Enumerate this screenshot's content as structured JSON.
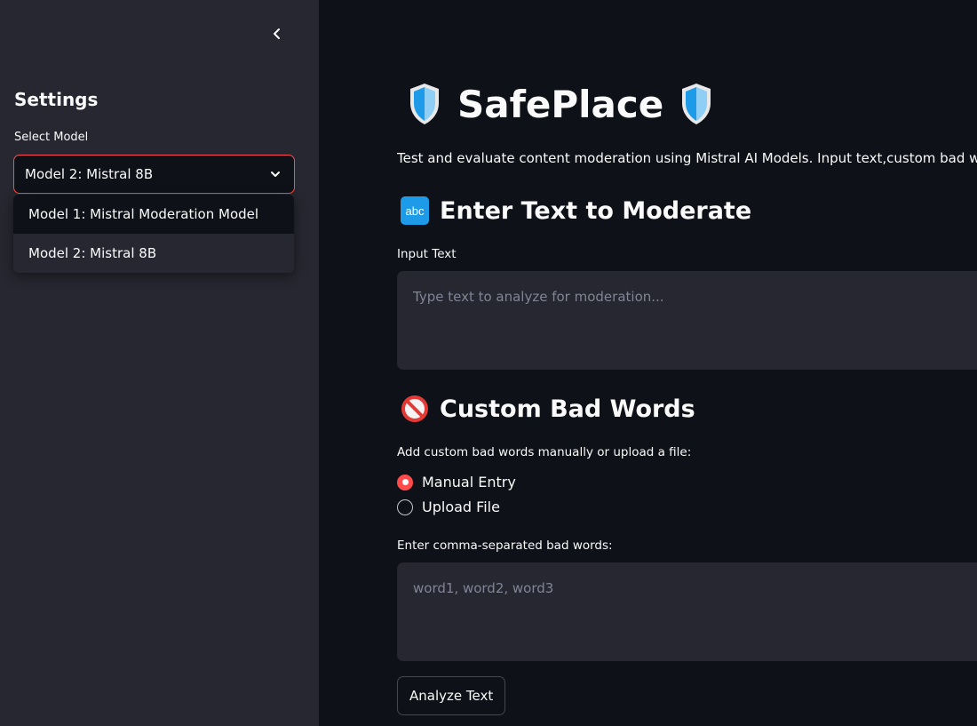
{
  "sidebar": {
    "collapse_icon": "chevron-left-icon",
    "title": "Settings",
    "select_label": "Select Model",
    "selected_value": "Model 2: Mistral 8B",
    "options": [
      "Model 1: Mistral Moderation Model",
      "Model 2: Mistral 8B"
    ]
  },
  "main": {
    "title": "SafePlace",
    "title_icon": "shield-icon",
    "description": "Test and evaluate content moderation using Mistral AI Models. Input text,custom bad words",
    "section1": {
      "icon": "abc-icon",
      "icon_text": "abc",
      "heading": "Enter Text to Moderate",
      "input_label": "Input Text",
      "input_placeholder": "Type text to analyze for moderation..."
    },
    "section2": {
      "icon": "prohibited-icon",
      "heading": "Custom Bad Words",
      "radio_label": "Add custom bad words manually or upload a file:",
      "radio_options": [
        "Manual Entry",
        "Upload File"
      ],
      "selected_radio": "Manual Entry",
      "words_label": "Enter comma-separated bad words:",
      "words_placeholder": "word1, word2, word3"
    },
    "analyze_button": "Analyze Text"
  },
  "colors": {
    "accent": "#ff4b4b",
    "background": "#0e1117",
    "sidebar": "#262730",
    "shield_blue": "#1e9be8"
  }
}
